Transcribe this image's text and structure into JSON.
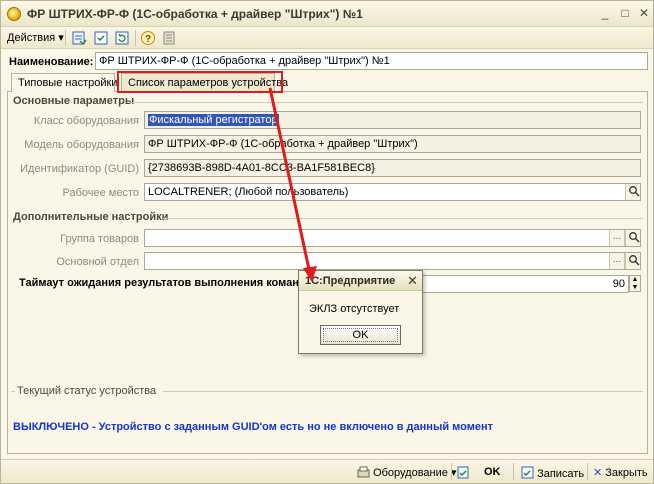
{
  "window": {
    "title": "ФР ШТРИХ-ФР-Ф (1С-обработка + драйвер \"Штрих\") №1",
    "minimize_glyph": "_",
    "maximize_glyph": "□",
    "close_glyph": "✕"
  },
  "toolbar": {
    "actions_label": "Действия",
    "actions_arrow": "▾"
  },
  "name": {
    "label": "Наименование:",
    "value": "ФР ШТРИХ-ФР-Ф (1С-обработка + драйвер \"Штрих\") №1"
  },
  "tabs": [
    {
      "label": "Типовые настройки",
      "active": true
    },
    {
      "label": "Список параметров устройства",
      "active": false
    }
  ],
  "basic": {
    "section_title": "Основные параметры",
    "fields": [
      {
        "label": "Класс оборудования",
        "value": "Фискальный регистратор"
      },
      {
        "label": "Модель оборудования",
        "value": "ФР ШТРИХ-ФР-Ф (1С-обработка + драйвер \"Штрих\")"
      },
      {
        "label": "Идентификатор (GUID)",
        "value": "{2738693B-898D-4A01-8CC3-BA1F581BEC8}"
      },
      {
        "label": "Рабочее место",
        "value": "LOCALTRENER; (Любой пользователь)"
      }
    ]
  },
  "additional": {
    "section_title": "Дополнительные настройки",
    "fields": [
      {
        "label": "Группа товаров",
        "value": ""
      },
      {
        "label": "Основной отдел",
        "value": ""
      }
    ],
    "picker_glyph": "...",
    "search_glyph": "🔍"
  },
  "timeout": {
    "label": "Таймаут ожидания результатов выполнения команды",
    "value": "90"
  },
  "status": {
    "section_title": "Текущий статус устройства",
    "text": "ВЫКЛЮЧЕНО - Устройство с заданным GUID'ом есть но не включено в данный момент"
  },
  "bottom": {
    "equipment_label": "Оборудование",
    "ok_label": "OK",
    "save_label": "Записать",
    "close_label": "Закрыть"
  },
  "dialog": {
    "title": "1С:Предприятие",
    "close_glyph": "✕",
    "message": "ЭКЛЗ отсутствует",
    "ok_label": "OK"
  },
  "colors": {
    "highlight": "#e01b1b",
    "status_text": "#1632d0",
    "selection": "#2f56b8"
  }
}
